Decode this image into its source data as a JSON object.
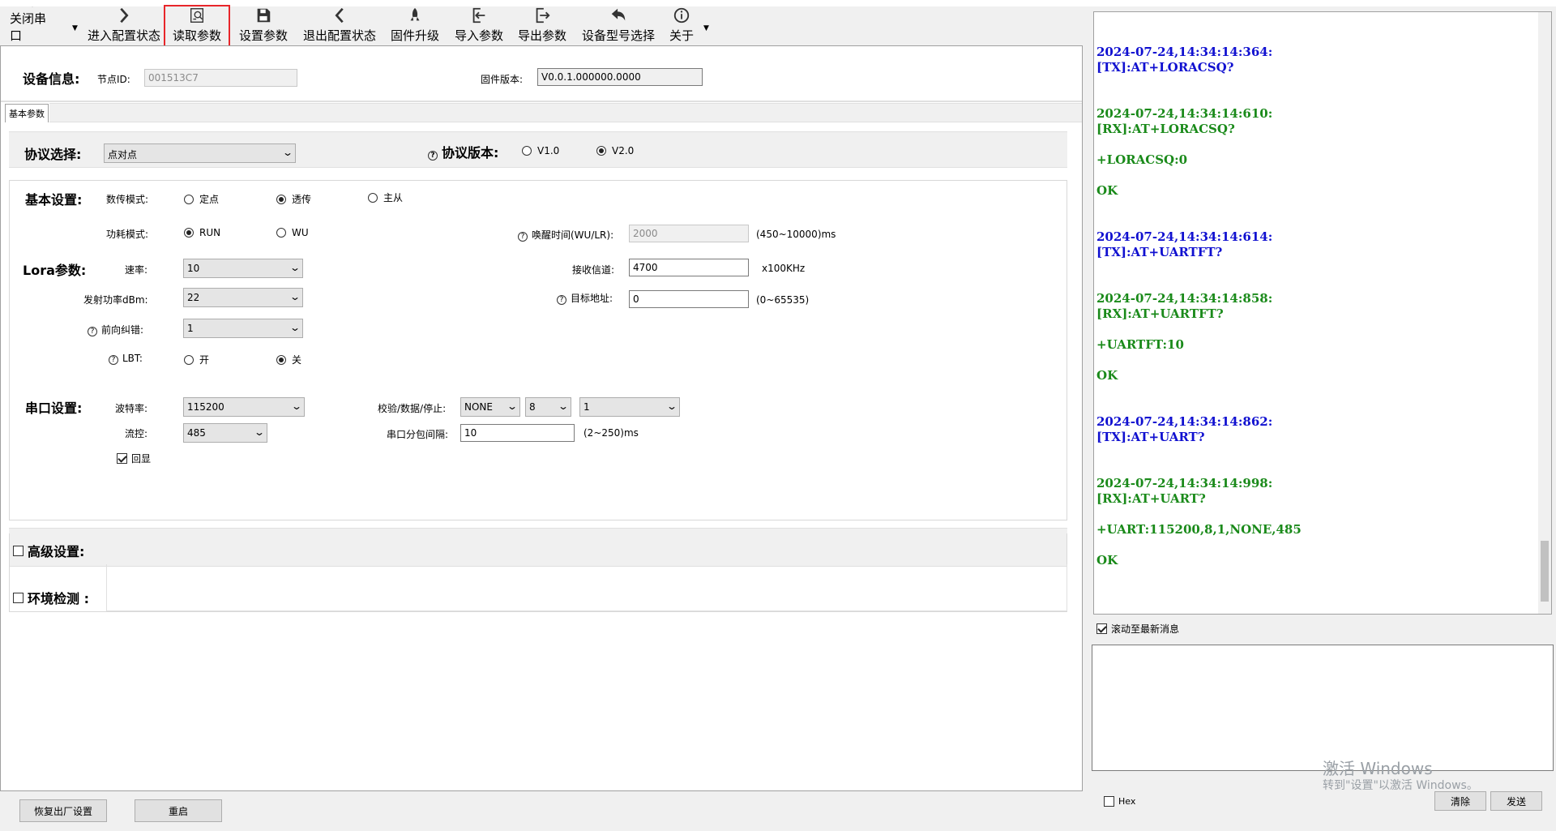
{
  "toolbar": {
    "close_port": "关闭串口",
    "enter_config": "进入配置状态",
    "read_params": "读取参数",
    "set_params": "设置参数",
    "exit_config": "退出配置状态",
    "firmware_upgrade": "固件升级",
    "import_params": "导入参数",
    "export_params": "导出参数",
    "device_model": "设备型号选择",
    "about": "关于"
  },
  "device_info": {
    "title": "设备信息:",
    "node_id_label": "节点ID:",
    "node_id_value": "001513C7",
    "fw_label": "固件版本:",
    "fw_value": "V0.0.1.000000.0000"
  },
  "tab": {
    "basic_params": "基本参数"
  },
  "protocol": {
    "select_label": "协议选择:",
    "select_value": "点对点",
    "version_label": "协议版本:",
    "v1": "V1.0",
    "v2": "V2.0",
    "selected": "V2.0"
  },
  "basic": {
    "title": "基本设置:",
    "transfer_mode_label": "数传模式:",
    "mode_fixed": "定点",
    "mode_transparent": "透传",
    "mode_master_slave": "主从",
    "power_mode_label": "功耗模式:",
    "power_run": "RUN",
    "power_wu": "WU",
    "wake_time_label": "唤醒时间(WU/LR):",
    "wake_time_value": "2000",
    "wake_time_range": "(450~10000)ms"
  },
  "lora": {
    "title": "Lora参数:",
    "rate_label": "速率:",
    "rate_value": "10",
    "tx_power_label": "发射功率dBm:",
    "tx_power_value": "22",
    "fec_label": "前向纠错:",
    "fec_value": "1",
    "lbt_label": "LBT:",
    "lbt_on": "开",
    "lbt_off": "关",
    "channel_label": "接收信道:",
    "channel_value": "4700",
    "channel_unit": "x100KHz",
    "target_label": "目标地址:",
    "target_value": "0",
    "target_range": "(0~65535)"
  },
  "serial": {
    "title": "串口设置:",
    "baud_label": "波特率:",
    "baud_value": "115200",
    "flow_label": "流控:",
    "flow_value": "485",
    "echo_label": "回显",
    "parity_label": "校验/数据/停止:",
    "parity_value": "NONE",
    "data_bits_value": "8",
    "stop_bits_value": "1",
    "packet_interval_label": "串口分包间隔:",
    "packet_interval_value": "10",
    "packet_interval_range": "(2~250)ms"
  },
  "advanced": {
    "label": "高级设置:"
  },
  "env": {
    "label": "环境检测 :"
  },
  "bottom": {
    "factory_reset": "恢复出厂设置",
    "restart": "重启"
  },
  "log": [
    {
      "type": "tx",
      "lines": [
        "2024-07-24,14:34:14:364:",
        "[TX]:AT+LORACSQ?"
      ]
    },
    {
      "type": "rx",
      "lines": [
        "2024-07-24,14:34:14:610:",
        "[RX]:AT+LORACSQ?",
        "",
        "+LORACSQ:0",
        "",
        "OK"
      ]
    },
    {
      "type": "tx",
      "lines": [
        "2024-07-24,14:34:14:614:",
        "[TX]:AT+UARTFT?"
      ]
    },
    {
      "type": "rx",
      "lines": [
        "2024-07-24,14:34:14:858:",
        "[RX]:AT+UARTFT?",
        "",
        "+UARTFT:10",
        "",
        "OK"
      ]
    },
    {
      "type": "tx",
      "lines": [
        "2024-07-24,14:34:14:862:",
        "[TX]:AT+UART?"
      ]
    },
    {
      "type": "rx",
      "lines": [
        "2024-07-24,14:34:14:998:",
        "[RX]:AT+UART?",
        "",
        "+UART:115200,8,1,NONE,485",
        "",
        "OK"
      ]
    }
  ],
  "log_panel": {
    "autoscroll_label": "滚动至最新消息",
    "hex_label": "Hex",
    "clear_button": "清除",
    "send_button": "发送"
  },
  "watermark": {
    "line1": "激活 Windows",
    "line2": "转到\"设置\"以激活 Windows。"
  },
  "colors": {
    "highlight": "#e8262a",
    "tx": "#1010d0",
    "rx": "#1a8a1a"
  },
  "icons": [
    "close-port-icon",
    "chevron-right-icon",
    "read-params-icon",
    "save-icon",
    "chevron-left-icon",
    "rocket-icon",
    "import-icon",
    "export-icon",
    "undo-arrow-icon",
    "info-icon"
  ]
}
